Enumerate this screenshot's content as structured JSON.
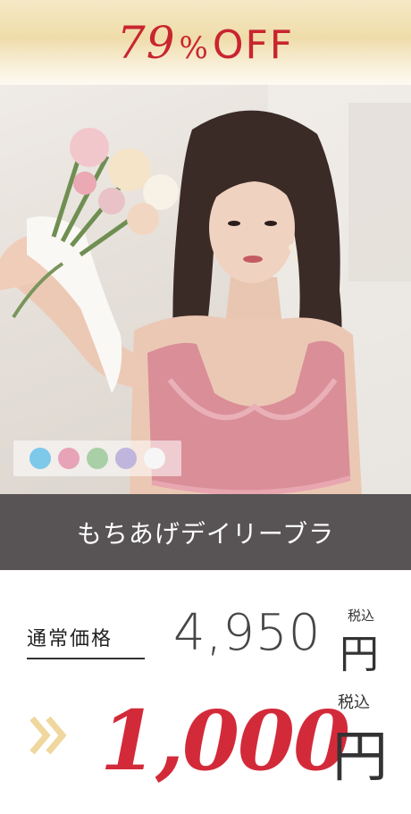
{
  "banner": {
    "discount_number": "79",
    "percent_sign": "%",
    "off_text": "OFF"
  },
  "product": {
    "name": "もちあげデイリーブラ"
  },
  "swatches": [
    {
      "color": "#7ec8ea"
    },
    {
      "color": "#e7a3b7"
    },
    {
      "color": "#a9cfa6"
    },
    {
      "color": "#c0b5dc"
    },
    {
      "color": "#f6f6f6"
    }
  ],
  "pricing": {
    "regular_label": "通常価格",
    "regular_price": "4,950",
    "sale_price": "1,000",
    "currency": "円",
    "tax_label": "税込"
  },
  "colors": {
    "accent": "#d32a3a",
    "bar": "#585455",
    "banner": "#efdcaa"
  }
}
